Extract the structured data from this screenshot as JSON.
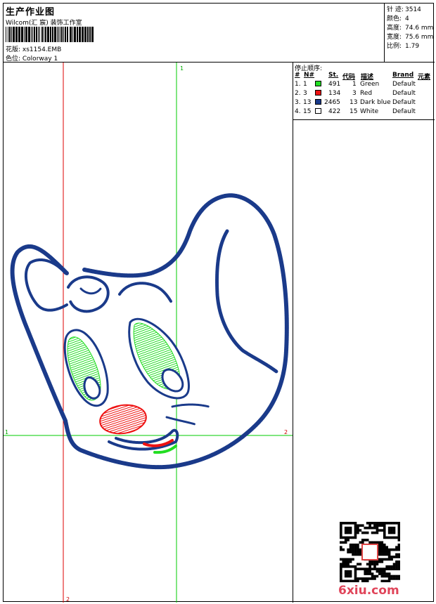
{
  "header": {
    "title": "生产作业图",
    "subtitle": "Wilcom(汇 宸) 装饰工作室",
    "design_line": "花版:  xs1154.EMB",
    "colorway_line": "色位:  Colorway 1"
  },
  "stats": [
    {
      "label": "针 迹:",
      "value": "3514"
    },
    {
      "label": "颜色:",
      "value": "4"
    },
    {
      "label": "高度:",
      "value": "74.6 mm"
    },
    {
      "label": "宽度:",
      "value": "75.6 mm"
    },
    {
      "label": "比例:",
      "value": "1.79"
    }
  ],
  "stop_sequence": {
    "title": "停止顺序:",
    "headers": {
      "num": "#",
      "needle": "N#",
      "stitches": "St.",
      "code": "代码",
      "desc": "描述",
      "brand": "Brand",
      "element": "元素"
    },
    "rows": [
      {
        "idx": "1.",
        "needle": "1",
        "stitches": "491",
        "code": "1",
        "desc": "Green",
        "brand": "Default",
        "color": "#22dd22"
      },
      {
        "idx": "2.",
        "needle": "3",
        "stitches": "134",
        "code": "3",
        "desc": "Red",
        "brand": "Default",
        "color": "#ee1111"
      },
      {
        "idx": "3.",
        "needle": "13",
        "stitches": "2465",
        "code": "13",
        "desc": "Dark blue",
        "brand": "Default",
        "color": "#1a3a8a"
      },
      {
        "idx": "4.",
        "needle": "15",
        "stitches": "422",
        "code": "15",
        "desc": "White",
        "brand": "Default",
        "color": "#ffffff"
      }
    ]
  },
  "guides": {
    "green_v_label": "1",
    "green_h_label_left": "1",
    "green_h_label_right": "2",
    "red_v_label": "2"
  },
  "colors": {
    "thread_green": "#22dd22",
    "thread_red": "#ee1111",
    "thread_blue": "#1a3a8a",
    "guide_green": "#00cc00",
    "guide_red": "#dd0000",
    "logo": "#e0455a"
  },
  "watermark": {
    "logo_text": "6xiu.com"
  }
}
